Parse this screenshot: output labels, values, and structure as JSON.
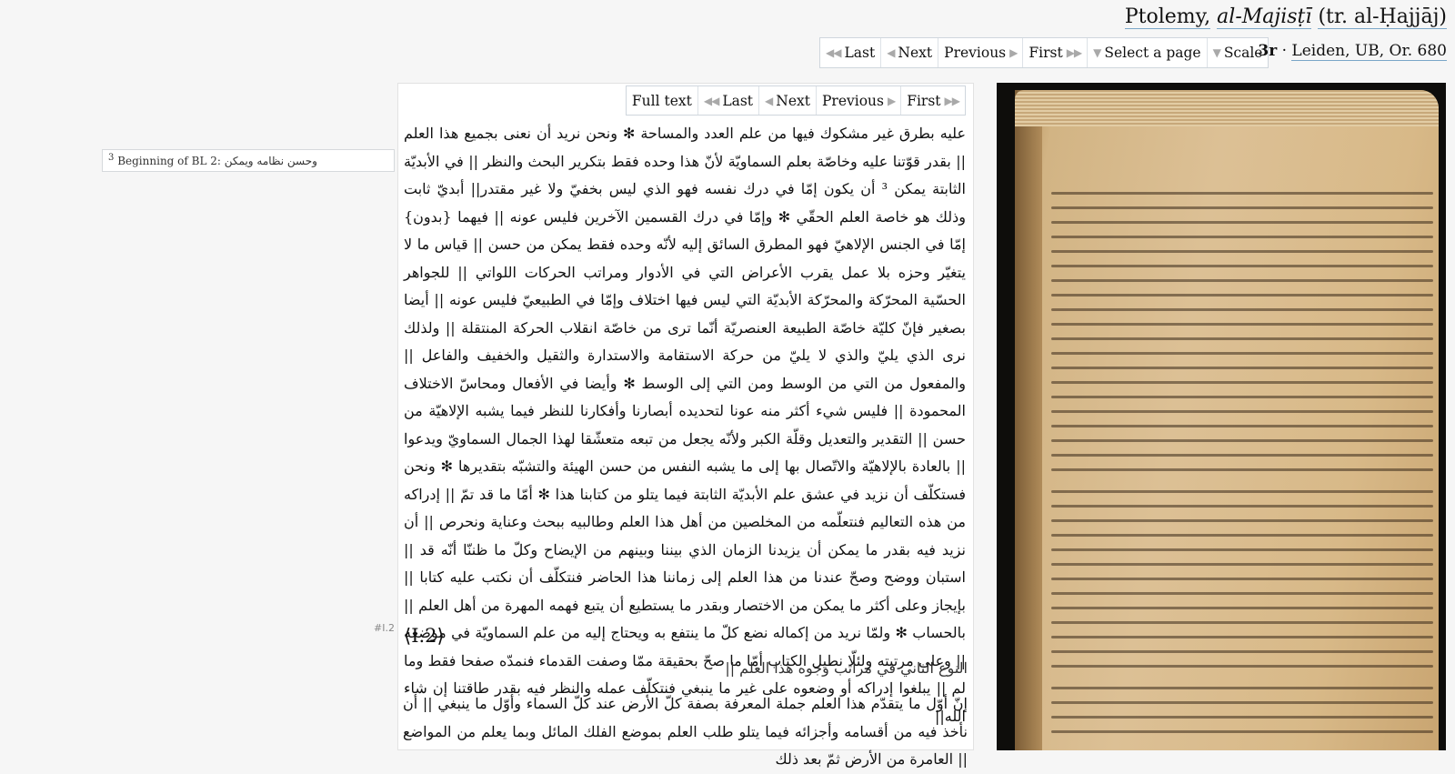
{
  "header": {
    "title_author": "Ptolemy,",
    "title_work": "al-Majisṭī",
    "title_trans": "(tr. al-Ḥajjāj)",
    "nav": [
      {
        "label": "Last"
      },
      {
        "label": "Next"
      },
      {
        "label": "Previous"
      },
      {
        "label": "First"
      },
      {
        "label": "Select a page"
      },
      {
        "label": "Scale"
      }
    ],
    "folio": "3r",
    "separator": "·",
    "library": "Leiden, UB, Or. 680"
  },
  "sidenote": {
    "num": "3",
    "label": "Beginning of BL 2:",
    "arabic": "وحسن نظامه ويمكن"
  },
  "text_nav": [
    {
      "label": "Full text"
    },
    {
      "label": "Last"
    },
    {
      "label": "Next"
    },
    {
      "label": "Previous"
    },
    {
      "label": "First"
    }
  ],
  "text": {
    "para1": "عليه بطرق غير مشكوك فيها من علم العدد والمساحة ✻ ونحن نريد أن نعنى بجميع هذا العلم || بقدر قوّتنا عليه وخاصّة بعلم السماويّة لأنّ هذا وحده فقط بتكرير البحث والنظر || في الأبديّة الثابتة يمكن ³ أن يكون إمّا في درك نفسه فهو الذي ليس بخفيّ ولا غير مقتدر|| أبديّ ثابت وذلك هو خاصة العلم الحقّي ✻ وإمّا في درك القسمين الآخرين فليس عونه || فيهما {بدون} إمّا في الجنس الإلاهيّ فهو المطرق السائق إليه لأنّه وحده فقط يمكن من حسن || قياس ما لا يتغيّر وحزه بلا عمل يقرب الأعراض التي في الأدوار ومراتب الحركات اللواتي || للجواهر الحسّية المحرّكة والمحرّكة الأبديّة التي ليس فيها اختلاف وإمّا في الطبيعيّ فليس عونه || أيضا بصغير فإنّ كليّة خاصّة الطبيعة العنصريّة أنّما ترى من خاصّة انقلاب الحركة المنتقلة || ولذلك نرى الذي يليّ والذي لا يليّ من حركة الاستقامة والاستدارة والثقيل والخفيف والفاعل || والمفعول من التي من الوسط ومن التي إلى الوسط ✻ وأيضا في الأفعال ومحاسّ الاختلاف المحمودة || فليس شيء أكثر منه عونا لتحديده أبصارنا وأفكارنا للنظر فيما يشبه الإلاهيّة من حسن || التقدير والتعديل وقلّة الكبر ولأنّه يجعل من تبعه متعشّقا لهذا الجمال السماويّ ويدعوا || بالعادة بالإلاهيّة والاتّصال بها إلى ما يشبه النفس من حسن الهيئة والتشبّه بتقديرها ✻ ونحن فستكلّف أن نزيد في عشق علم الأبديّة الثابتة فيما يتلو من كتابنا هذا ✻ أمّا ما قد تمّ || إدراكه من هذه التعاليم فنتعلّمه من المخلصين من أهل هذا العلم وطالبيه ببحث وعناية ونحرص || أن نزيد فيه بقدر ما يمكن أن يزيدنا الزمان الذي بيننا وبينهم من الإيضاح وكلّ ما ظننّا أنّه قد || استبان ووضح وصحّ عندنا من هذا العلم إلى زماننا هذا الحاضر فنتكلّف أن نكتب عليه كتابا || بإيجاز وعلى أكثر ما يمكن من الاختصار وبقدر ما يستطيع أن يتبع فهمه المهرة من أهل العلم || بالحساب ✻ ولمّا نريد من إكماله نضع كلّ ما ينتفع به ويحتاج إليه من علم السماويّة في موضعه || وعلى مرتبته ولئلّا نطيل الكتاب أمّا ما صحّ بحقيقة ممّا وصفت القدماء فنمدّه صفحا فقط وما لم || يبلغوا إدراكه أو وضعوه على غير ما ينبغي فنتكلّف عمله والنظر فيه بقدر طاقتنا إن شاء الله||",
    "sec_label": "#I.2",
    "sec_heading": "⟨I.2⟩",
    "sub_heading": "النوع الثاني في مراتب وجوه هذا العلم ||",
    "para2": "إنّ أوّل ما يتقدّم هذا العلم جملة المعرفة بصفة كلّ الأرض عند كلّ السماء وأوّل ما ينبغي || أن نأخذ فيه من أقسامه وأجزائه فيما يتلو طلب العلم بموضع الفلك المائل وبما يعلم من المواضع || العامرة من الأرض ثمّ بعد ذلك"
  }
}
